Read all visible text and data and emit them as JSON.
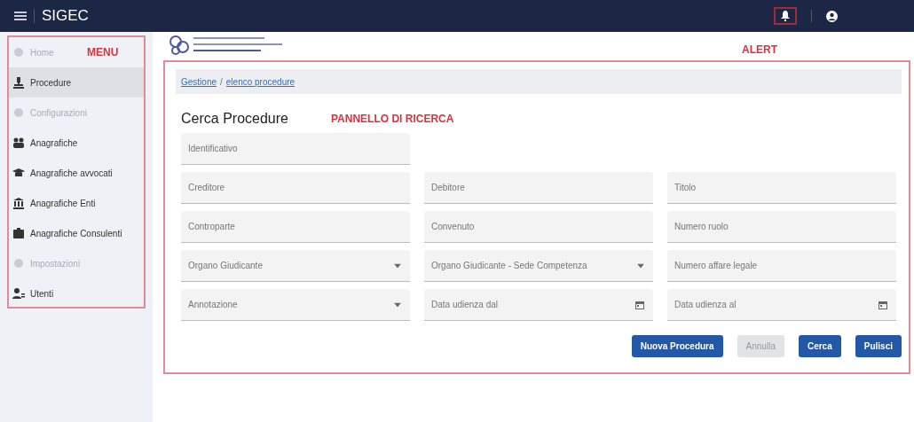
{
  "navbar": {
    "title": "SIGEC"
  },
  "sidebar": {
    "items": [
      {
        "label": "Home",
        "disabled": true,
        "selected": false
      },
      {
        "label": "Procedure",
        "disabled": false,
        "selected": true
      },
      {
        "label": "Configurazioni",
        "disabled": true,
        "selected": false
      },
      {
        "label": "Anagrafiche",
        "disabled": false,
        "selected": false
      },
      {
        "label": "Anagrafiche avvocati",
        "disabled": false,
        "selected": false
      },
      {
        "label": "Anagrafiche Enti",
        "disabled": false,
        "selected": false
      },
      {
        "label": "Anagrafiche Consulenti",
        "disabled": false,
        "selected": false
      },
      {
        "label": "Impostazioni",
        "disabled": true,
        "selected": false
      },
      {
        "label": "Utenti",
        "disabled": false,
        "selected": false
      }
    ]
  },
  "breadcrumb": {
    "separator": "/",
    "items": [
      {
        "label": "Gestione"
      },
      {
        "label": "elenco procedure"
      }
    ]
  },
  "title": "Cerca Procedure",
  "fields": [
    [
      {
        "placeholder": "Identificativo",
        "kind": "text"
      }
    ],
    [
      {
        "placeholder": "Creditore",
        "kind": "text"
      },
      {
        "placeholder": "Debitore",
        "kind": "text"
      },
      {
        "placeholder": "Titolo",
        "kind": "text"
      }
    ],
    [
      {
        "placeholder": "Controparte",
        "kind": "text"
      },
      {
        "placeholder": "Convenuto",
        "kind": "text"
      },
      {
        "placeholder": "Numero ruolo",
        "kind": "text"
      }
    ],
    [
      {
        "placeholder": "Organo Giudicante",
        "kind": "select"
      },
      {
        "placeholder": "Organo Giudicante - Sede Competenza",
        "kind": "select"
      },
      {
        "placeholder": "Numero affare legale",
        "kind": "text"
      }
    ],
    [
      {
        "placeholder": "Annotazione",
        "kind": "select"
      },
      {
        "placeholder": "Data udienza dal",
        "kind": "date"
      },
      {
        "placeholder": "Data udienza al",
        "kind": "date"
      }
    ]
  ],
  "buttons": [
    {
      "label": "Nuova Procedura",
      "disabled": false
    },
    {
      "label": "Annulla",
      "disabled": true
    },
    {
      "label": "Cerca",
      "disabled": false
    },
    {
      "label": "Pulisci",
      "disabled": false
    }
  ],
  "annotations": {
    "menu": "MENU",
    "alert": "ALERT",
    "panel": "PANNELLO DI RICERCA"
  }
}
